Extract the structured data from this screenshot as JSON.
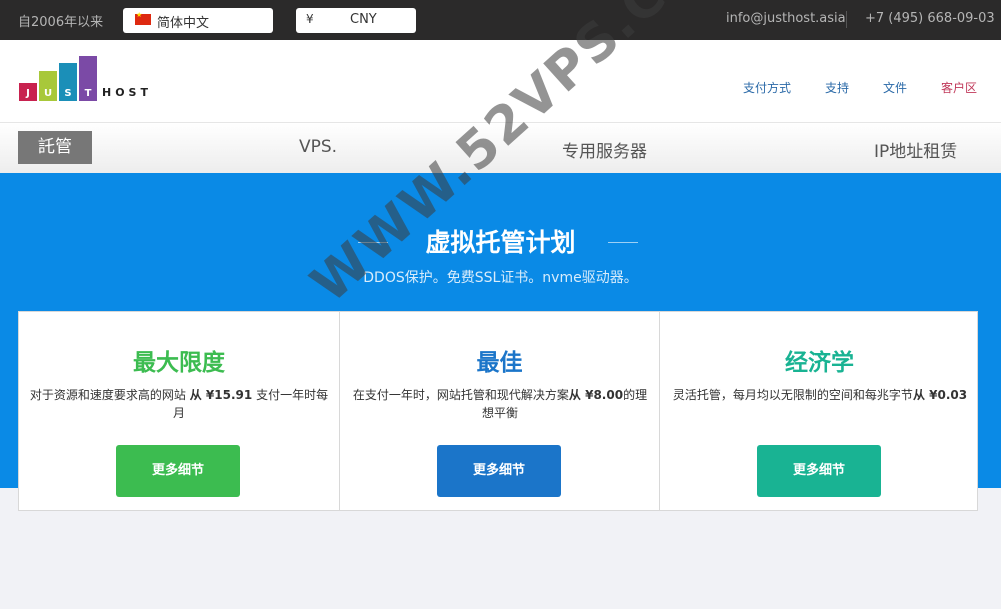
{
  "topbar": {
    "since": "自2006年以来",
    "language": "简体中文",
    "currency_symbol": "¥",
    "currency": "CNY",
    "email": "info@justhost.asia",
    "phone": "+7 (495) 668-09-03"
  },
  "logo": {
    "letters": [
      "J",
      "U",
      "S",
      "T"
    ],
    "host": "HOST",
    "colors": [
      "#c8224f",
      "#a8c83a",
      "#1b8fb8",
      "#7b4aa6"
    ]
  },
  "nav": {
    "links": [
      "支付方式",
      "支持",
      "文件",
      "客户区"
    ]
  },
  "tabs": [
    "託管",
    "VPS.",
    "专用服务器",
    "IP地址租赁"
  ],
  "hero": {
    "title": "虚拟托管计划",
    "subtitle": "DDOS保护。免费SSL证书。nvme驱动器。"
  },
  "plans": [
    {
      "name": "最大限度",
      "desc_before": "对于资源和速度要求高的网站",
      "price": "从 ¥15.91",
      "desc_after": "支付一年时每月",
      "button": "更多细节",
      "color": "#3cbc50"
    },
    {
      "name": "最佳",
      "desc_before": "在支付一年时，网站托管和现代解决方案",
      "price": "从 ¥8.00",
      "desc_after": "的理想平衡",
      "button": "更多细节",
      "color": "#1b75c9"
    },
    {
      "name": "经济学",
      "desc_before": "灵活托管，每月均以无限制的空间和每兆字节",
      "price": "从 ¥0.03",
      "desc_after": "",
      "button": "更多细节",
      "color": "#19b393"
    }
  ],
  "watermark": "WWW.52VPS.COM",
  "colors": {
    "topbar_bg": "#2b2a2a",
    "hero_bg": "#0a8ae6",
    "nav_link": "#2b6aa8",
    "client_link": "#c0395a"
  }
}
